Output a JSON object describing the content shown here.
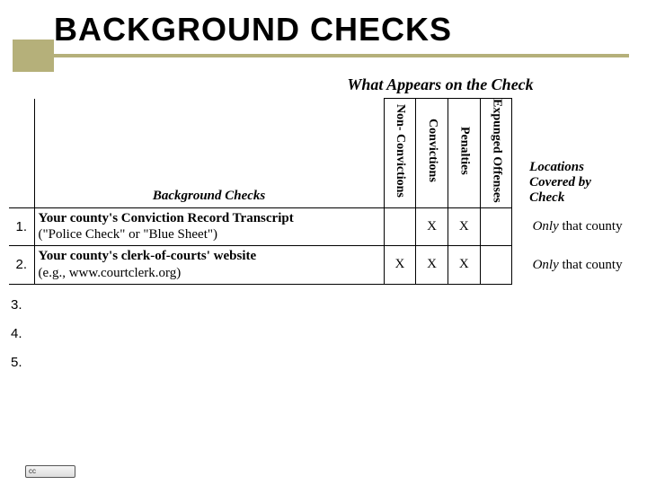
{
  "title": "BACKGROUND CHECKS",
  "section_header": "What Appears on the Check",
  "headers": {
    "background_checks": "Background Checks",
    "non_convictions": "Non-\nConvictions",
    "convictions": "Convictions",
    "penalties": "Penalties",
    "expunged": "Expunged\nOffenses",
    "locations": "Locations\nCovered\nby Check"
  },
  "rows": [
    {
      "num": "1.",
      "desc_bold": "Your county's Conviction Record Transcript",
      "desc_rest": "(\"Police Check\" or \"Blue Sheet\")",
      "non": "",
      "conv": "X",
      "pen": "X",
      "exp": "",
      "loc_italic": "Only",
      "loc_rest": " that county"
    },
    {
      "num": "2.",
      "desc_bold": "Your county's clerk-of-courts' website",
      "desc_rest": "(e.g., www.courtclerk.org)",
      "non": "X",
      "conv": "X",
      "pen": "X",
      "exp": "",
      "loc_italic": "Only",
      "loc_rest": " that county"
    }
  ],
  "empty_rows": [
    "3.",
    "4.",
    "5."
  ],
  "cc_text": "cc"
}
